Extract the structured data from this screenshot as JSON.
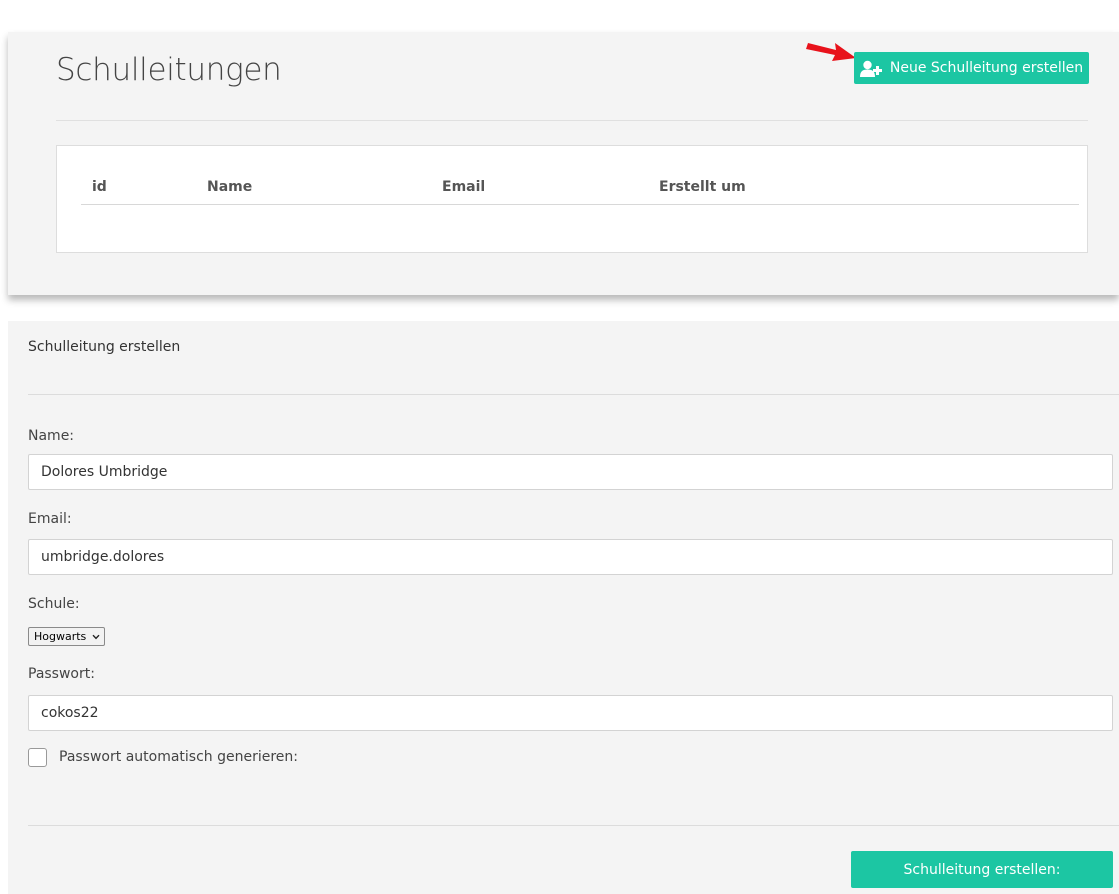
{
  "header": {
    "title": "Schulleitungen",
    "new_button_label": "Neue Schulleitung erstellen",
    "new_button_icon": "add-user-icon",
    "accent_color": "#1cc6a3",
    "annotation_arrow_color": "#e8121b"
  },
  "table": {
    "columns": [
      "id",
      "Name",
      "Email",
      "Erstellt um"
    ],
    "rows": []
  },
  "form": {
    "title": "Schulleitung erstellen",
    "name_label": "Name:",
    "name_value": "Dolores Umbridge",
    "email_label": "Email:",
    "email_value": "umbridge.dolores",
    "school_label": "Schule:",
    "school_selected": "Hogwarts",
    "password_label": "Passwort:",
    "password_value": "cokos22",
    "auto_password_label": "Passwort automatisch generieren:",
    "auto_password_checked": false,
    "submit_label": "Schulleitung erstellen:"
  }
}
